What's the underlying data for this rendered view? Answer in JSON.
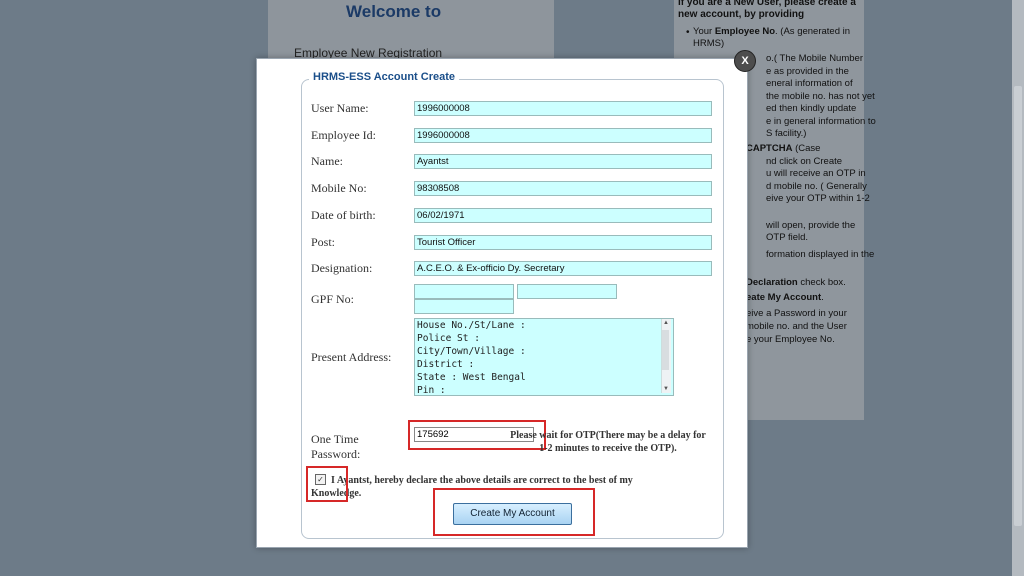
{
  "background": {
    "welcome": "Welcome to",
    "registration": "Employee New Registration"
  },
  "right_panel": {
    "heading": "If you are a New User, please create a new account, by providing",
    "lines": [
      {
        "pre": "Your ",
        "bold": "Employee No",
        "post": ". (As generated in"
      },
      {
        "pre": "HRMS)",
        "bold": "",
        "post": ""
      },
      {
        "pre": "",
        "bold": "",
        "post": "o.( The Mobile Number"
      },
      {
        "pre": "",
        "bold": "",
        "post": "e as provided in the"
      },
      {
        "pre": "",
        "bold": "",
        "post": "eneral information of"
      },
      {
        "pre": "",
        "bold": "",
        "post": "the mobile no. has not yet"
      },
      {
        "pre": "",
        "bold": "",
        "post": "ed then kindly update"
      },
      {
        "pre": "",
        "bold": "",
        "post": "e in general information to"
      },
      {
        "pre": "",
        "bold": "",
        "post": "S facility.)"
      },
      {
        "pre": "",
        "bold": "CAPTCHA",
        "post": " (Case"
      },
      {
        "pre": "",
        "bold": "",
        "post": "nd click on Create"
      },
      {
        "pre": "",
        "bold": "",
        "post": "u will receive an OTP in"
      },
      {
        "pre": "",
        "bold": "",
        "post": "d mobile no. ( Generally"
      },
      {
        "pre": "",
        "bold": "",
        "post": "eive your OTP within 1-2"
      },
      {
        "pre": "",
        "bold": "",
        "post": ""
      },
      {
        "pre": "",
        "bold": "",
        "post": "will open, provide the"
      },
      {
        "pre": "",
        "bold": "",
        "post": "OTP field."
      },
      {
        "pre": "",
        "bold": "",
        "post": "formation displayed in the"
      },
      {
        "pre": "",
        "bold": "",
        "post": ""
      },
      {
        "pre": "",
        "bold": "Declaration",
        "post": " check box."
      },
      {
        "pre": "",
        "bold": "eate My Account",
        "post": "."
      },
      {
        "pre": "",
        "bold": "",
        "post": "eive a Password in your"
      },
      {
        "pre": "",
        "bold": "",
        "post": "mobile no. and the User"
      },
      {
        "pre": "",
        "bold": "",
        "post": "e your Employee No."
      }
    ]
  },
  "modal": {
    "close_label": "X",
    "legend": "HRMS-ESS Account Create",
    "fields": {
      "user_name": {
        "label": "User Name:",
        "value": "1996000008"
      },
      "employee_id": {
        "label": "Employee Id:",
        "value": "1996000008"
      },
      "name": {
        "label": "Name:",
        "value": "Ayantst"
      },
      "mobile": {
        "label": "Mobile No:",
        "value": "98308508"
      },
      "dob": {
        "label": "Date of birth:",
        "value": "06/02/1971"
      },
      "post": {
        "label": "Post:",
        "value": "Tourist Officer"
      },
      "designation": {
        "label": "Designation:",
        "value": "A.C.E.O. & Ex-officio Dy. Secretary"
      },
      "gpf": {
        "label": "GPF No:",
        "value1": "",
        "value2": "",
        "value3": ""
      },
      "address": {
        "label": "Present Address:",
        "lines": [
          "House No./St/Lane :",
          "Police St :",
          "City/Town/Village :",
          "District :",
          "State : West Bengal",
          "Pin :"
        ]
      },
      "otp": {
        "label_line1": "One Time",
        "label_line2": "Password:",
        "value": "175692"
      }
    },
    "otp_note": "Please wait for OTP(There may be a delay for 1-2 minutes to receive the OTP).",
    "checkbox_mark": "✓",
    "declaration": "I Ayantst, hereby declare the above details are correct to the best of my Knowledge.",
    "create_button": "Create My Account"
  },
  "colors": {
    "input_bg": "#ccffff",
    "highlight_red": "#d62828",
    "legend_blue": "#1b4f8a"
  }
}
